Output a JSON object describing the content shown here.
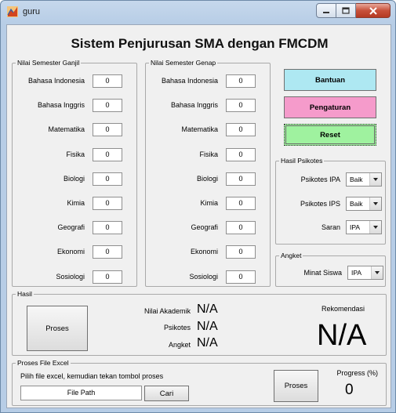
{
  "window": {
    "title": "guru"
  },
  "heading": "Sistem Penjurusan SMA dengan FMCDM",
  "ganjil": {
    "title": "Nilai Semester Ganjil",
    "subjects": [
      {
        "label": "Bahasa Indonesia",
        "value": "0"
      },
      {
        "label": "Bahasa Inggris",
        "value": "0"
      },
      {
        "label": "Matematika",
        "value": "0"
      },
      {
        "label": "Fisika",
        "value": "0"
      },
      {
        "label": "Biologi",
        "value": "0"
      },
      {
        "label": "Kimia",
        "value": "0"
      },
      {
        "label": "Geografi",
        "value": "0"
      },
      {
        "label": "Ekonomi",
        "value": "0"
      },
      {
        "label": "Sosiologi",
        "value": "0"
      }
    ]
  },
  "genap": {
    "title": "Nilai Semester Genap",
    "subjects": [
      {
        "label": "Bahasa Indonesia",
        "value": "0"
      },
      {
        "label": "Bahasa Inggris",
        "value": "0"
      },
      {
        "label": "Matematika",
        "value": "0"
      },
      {
        "label": "Fisika",
        "value": "0"
      },
      {
        "label": "Biologi",
        "value": "0"
      },
      {
        "label": "Kimia",
        "value": "0"
      },
      {
        "label": "Geografi",
        "value": "0"
      },
      {
        "label": "Ekonomi",
        "value": "0"
      },
      {
        "label": "Sosiologi",
        "value": "0"
      }
    ]
  },
  "buttons": {
    "bantuan": "Bantuan",
    "pengaturan": "Pengaturan",
    "reset": "Reset"
  },
  "psikotes": {
    "title": "Hasil Psikotes",
    "ipa_label": "Psikotes IPA",
    "ipa_value": "Baik",
    "ips_label": "Psikotes IPS",
    "ips_value": "Baik",
    "saran_label": "Saran",
    "saran_value": "IPA"
  },
  "angket": {
    "title": "Angket",
    "minat_label": "Minat Siswa",
    "minat_value": "IPA"
  },
  "hasil": {
    "title": "Hasil",
    "proses_label": "Proses",
    "akademik_label": "Nilai Akademik",
    "akademik_value": "N/A",
    "psikotes_label": "Psikotes",
    "psikotes_value": "N/A",
    "angket_label": "Angket",
    "angket_value": "N/A",
    "rekomendasi_label": "Rekomendasi",
    "rekomendasi_value": "N/A"
  },
  "excel": {
    "title": "Proses File Excel",
    "instruction": "Pilih file excel, kemudian tekan tombol proses",
    "file_path": "File Path",
    "cari_label": "Cari",
    "proses_label": "Proses",
    "progress_label": "Progress (%)",
    "progress_value": "0"
  },
  "colors": {
    "bantuan": "#aee8f2",
    "pengaturan": "#f59bcb",
    "reset": "#9ff29f"
  },
  "icons": {
    "app": "matlab-figure-icon",
    "minimize": "minimize-icon",
    "maximize": "maximize-icon",
    "close": "close-icon"
  }
}
